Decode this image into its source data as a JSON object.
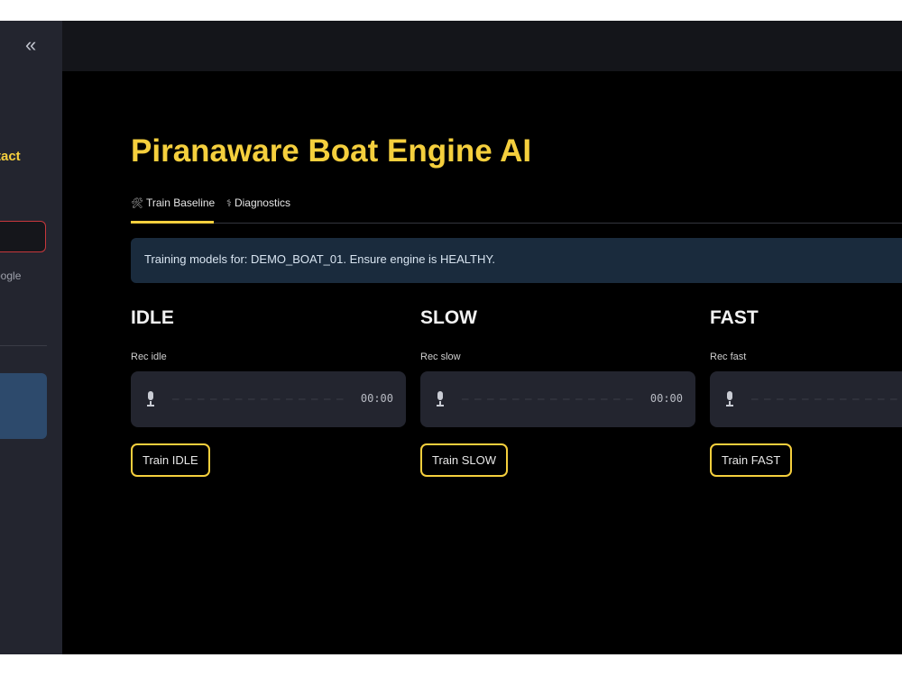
{
  "sidebar": {
    "collapse_icon": "«",
    "partial_title": "tact",
    "partial_link": "oogle"
  },
  "page": {
    "title": "Piranaware Boat Engine AI"
  },
  "tabs": [
    {
      "label": "Train Baseline",
      "icon": "🛠",
      "active": true
    },
    {
      "label": "Diagnostics",
      "icon": "⚕",
      "active": false
    }
  ],
  "info": {
    "message": "Training models for: DEMO_BOAT_01. Ensure engine is HEALTHY."
  },
  "columns": [
    {
      "heading": "IDLE",
      "rec_label": "Rec idle",
      "timer": "00:00",
      "button": "Train IDLE"
    },
    {
      "heading": "SLOW",
      "rec_label": "Rec slow",
      "timer": "00:00",
      "button": "Train SLOW"
    },
    {
      "heading": "FAST",
      "rec_label": "Rec fast",
      "timer": "",
      "button": "Train FAST"
    }
  ],
  "colors": {
    "accent": "#f5cf3d",
    "background": "#000000",
    "sidebar": "#23252f",
    "info_bg": "#1a2b3d",
    "error_border": "#c8373c"
  }
}
